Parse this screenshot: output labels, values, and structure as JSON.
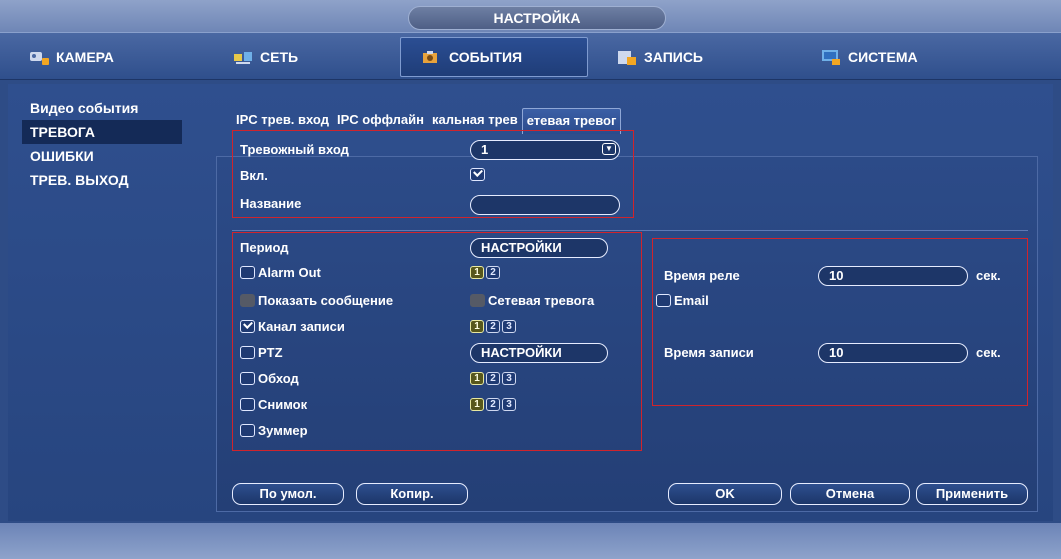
{
  "window": {
    "title": "НАСТРОЙКА"
  },
  "tabs": [
    {
      "label": "КАМЕРА",
      "icon": "camera-icon"
    },
    {
      "label": "СЕТЬ",
      "icon": "network-icon"
    },
    {
      "label": "СОБЫТИЯ",
      "icon": "events-icon"
    },
    {
      "label": "ЗАПИСЬ",
      "icon": "record-icon"
    },
    {
      "label": "СИСТЕМА",
      "icon": "system-icon"
    }
  ],
  "sidebar": {
    "items": [
      {
        "label": "Видео события"
      },
      {
        "label": "ТРЕВОГА"
      },
      {
        "label": "ОШИБКИ"
      },
      {
        "label": "ТРЕВ. ВЫХОД"
      }
    ]
  },
  "subtabs": [
    {
      "label": "IPC трев. вход"
    },
    {
      "label": "IPC оффлайн"
    },
    {
      "label": "кальная трев"
    },
    {
      "label": "етевая тревог"
    }
  ],
  "form": {
    "alarm_input_label": "Тревожный вход",
    "alarm_input_value": "1",
    "enable_label": "Вкл.",
    "name_label": "Название",
    "name_value": ""
  },
  "actions": {
    "period_label": "Период",
    "settings_label": "НАСТРОЙКИ",
    "alarm_out_label": "Alarm Out",
    "alarm_out_channels": [
      "1",
      "2"
    ],
    "show_message_label": "Показать сообщение",
    "net_alarm_label": "Сетевая тревога",
    "email_label": "Email",
    "record_channel_label": "Канал записи",
    "record_channels": [
      "1",
      "2",
      "3"
    ],
    "ptz_label": "PTZ",
    "ptz_settings_label": "НАСТРОЙКИ",
    "tour_label": "Обход",
    "tour_channels": [
      "1",
      "2",
      "3"
    ],
    "snapshot_label": "Снимок",
    "snapshot_channels": [
      "1",
      "2",
      "3"
    ],
    "buzzer_label": "Зуммер"
  },
  "timing": {
    "relay_time_label": "Время реле",
    "relay_time_value": "10",
    "record_time_label": "Время записи",
    "record_time_value": "10",
    "unit": "сек."
  },
  "buttons": {
    "default": "По умол.",
    "copy": "Копир.",
    "ok": "OK",
    "cancel": "Отмена",
    "apply": "Применить"
  },
  "colors": {
    "highlight_box": "#d0242c",
    "panel": "#2c4b88",
    "accent": "#e8e8a0"
  }
}
